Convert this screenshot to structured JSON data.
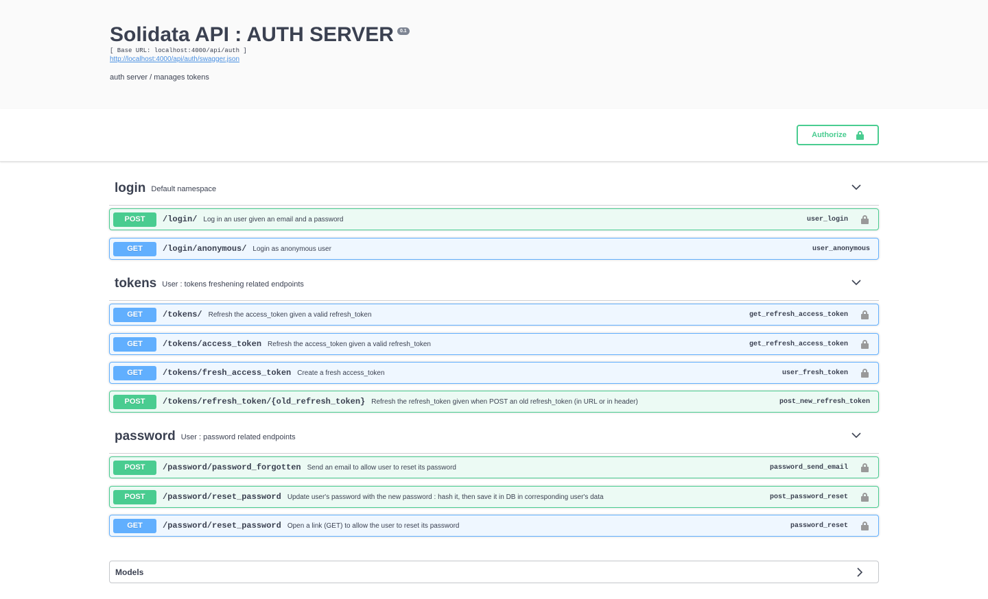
{
  "info": {
    "title": "Solidata API : AUTH SERVER",
    "version": "0.1",
    "base_url": "[ Base URL: localhost:4000/api/auth ]",
    "spec_link": "http://localhost:4000/api/auth/swagger.json",
    "description": "auth server / manages tokens"
  },
  "authorize": {
    "label": "Authorize",
    "icon": "unlocked-icon",
    "color": "#49cc90"
  },
  "colors": {
    "post": "#49cc90",
    "get": "#61affe",
    "text": "#3b4151"
  },
  "tags": [
    {
      "name": "login",
      "description": "Default namespace",
      "operations": [
        {
          "method": "POST",
          "path": "/login/",
          "summary": "Log in an user given an email and a password",
          "operation_id": "user_login",
          "locked": true
        },
        {
          "method": "GET",
          "path": "/login/anonymous/",
          "summary": "Login as anonymous user",
          "operation_id": "user_anonymous",
          "locked": false
        }
      ]
    },
    {
      "name": "tokens",
      "description": "User : tokens freshening related endpoints",
      "operations": [
        {
          "method": "GET",
          "path": "/tokens/",
          "summary": "Refresh the access_token given a valid refresh_token",
          "operation_id": "get_refresh_access_token",
          "locked": true
        },
        {
          "method": "GET",
          "path": "/tokens/access_token",
          "summary": "Refresh the access_token given a valid refresh_token",
          "operation_id": "get_refresh_access_token",
          "locked": true
        },
        {
          "method": "GET",
          "path": "/tokens/fresh_access_token",
          "summary": "Create a fresh access_token",
          "operation_id": "user_fresh_token",
          "locked": true
        },
        {
          "method": "POST",
          "path": "/tokens/refresh_token/{old_refresh_token}",
          "summary": "Refresh the refresh_token given when POST an old refresh_token (in URL or in header)",
          "operation_id": "post_new_refresh_token",
          "locked": false
        }
      ]
    },
    {
      "name": "password",
      "description": "User : password related endpoints",
      "operations": [
        {
          "method": "POST",
          "path": "/password/password_forgotten",
          "summary": "Send an email to allow user to reset its password",
          "operation_id": "password_send_email",
          "locked": true
        },
        {
          "method": "POST",
          "path": "/password/reset_password",
          "summary": "Update user's password with the new password : hash it, then save it in DB in corresponding user's data",
          "operation_id": "post_password_reset",
          "locked": true
        },
        {
          "method": "GET",
          "path": "/password/reset_password",
          "summary": "Open a link (GET) to allow the user to reset its password",
          "operation_id": "password_reset",
          "locked": true
        }
      ]
    }
  ],
  "models": {
    "title": "Models"
  }
}
